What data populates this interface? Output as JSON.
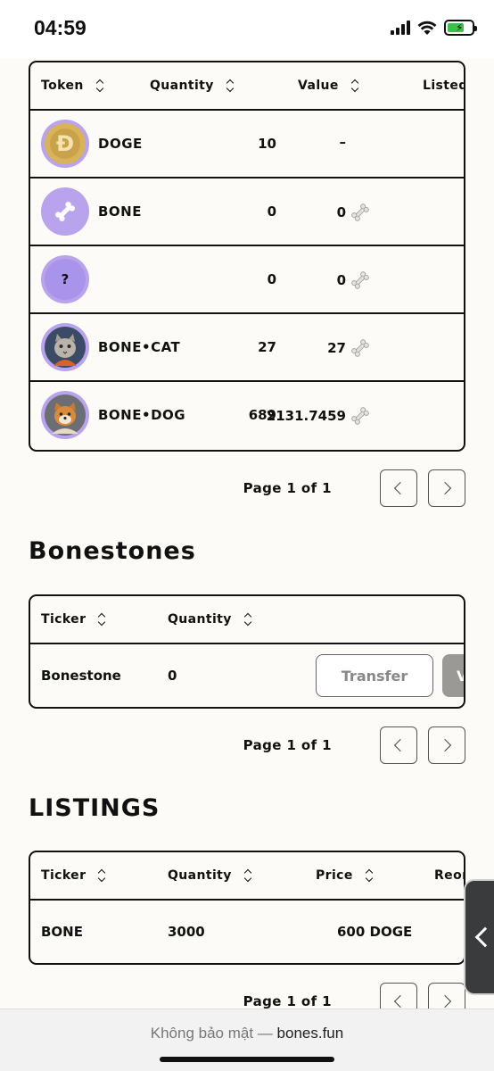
{
  "status_bar": {
    "time": "04:59"
  },
  "tokens_table": {
    "headers": {
      "token": "Token",
      "quantity": "Quantity",
      "value": "Value",
      "listed": "Listed"
    },
    "rows": [
      {
        "name": "DOGE",
        "quantity": "10",
        "value": "–",
        "icon": "doge-coin-icon",
        "show_bone": false
      },
      {
        "name": "BONE",
        "quantity": "0",
        "value": "0",
        "icon": "bone-icon",
        "show_bone": true
      },
      {
        "name": "",
        "quantity": "0",
        "value": "0",
        "icon": "?",
        "show_bone": true
      },
      {
        "name": "BONE•CAT",
        "quantity": "27",
        "value": "27",
        "icon": "cat-avatar-icon",
        "show_bone": true
      },
      {
        "name": "BONE•DOG",
        "quantity": "689",
        "value": "2131.7459",
        "icon": "dog-avatar-icon",
        "show_bone": true
      }
    ],
    "pagination": "Page 1 of 1"
  },
  "bonestones": {
    "title": "Bonestones",
    "headers": {
      "ticker": "Ticker",
      "quantity": "Quantity"
    },
    "rows": [
      {
        "ticker": "Bonestone",
        "quantity": "0",
        "transfer_label": "Transfer",
        "second_action_label": "V"
      }
    ],
    "pagination": "Page 1 of 1"
  },
  "listings": {
    "title": "LISTINGS",
    "headers": {
      "ticker": "Ticker",
      "quantity": "Quantity",
      "price": "Price",
      "reorder": "Reor"
    },
    "rows": [
      {
        "ticker": "BONE",
        "quantity": "3000",
        "price": "600 DOGE"
      }
    ],
    "pagination": "Page 1 of 1"
  },
  "browser": {
    "security_label": "Không bảo mật — ",
    "domain": "bones.fun"
  },
  "colors": {
    "avatar_bg": "#b8a3ec",
    "doge_gold": "#d8b35a",
    "page_bg": "#fcfbf7"
  }
}
